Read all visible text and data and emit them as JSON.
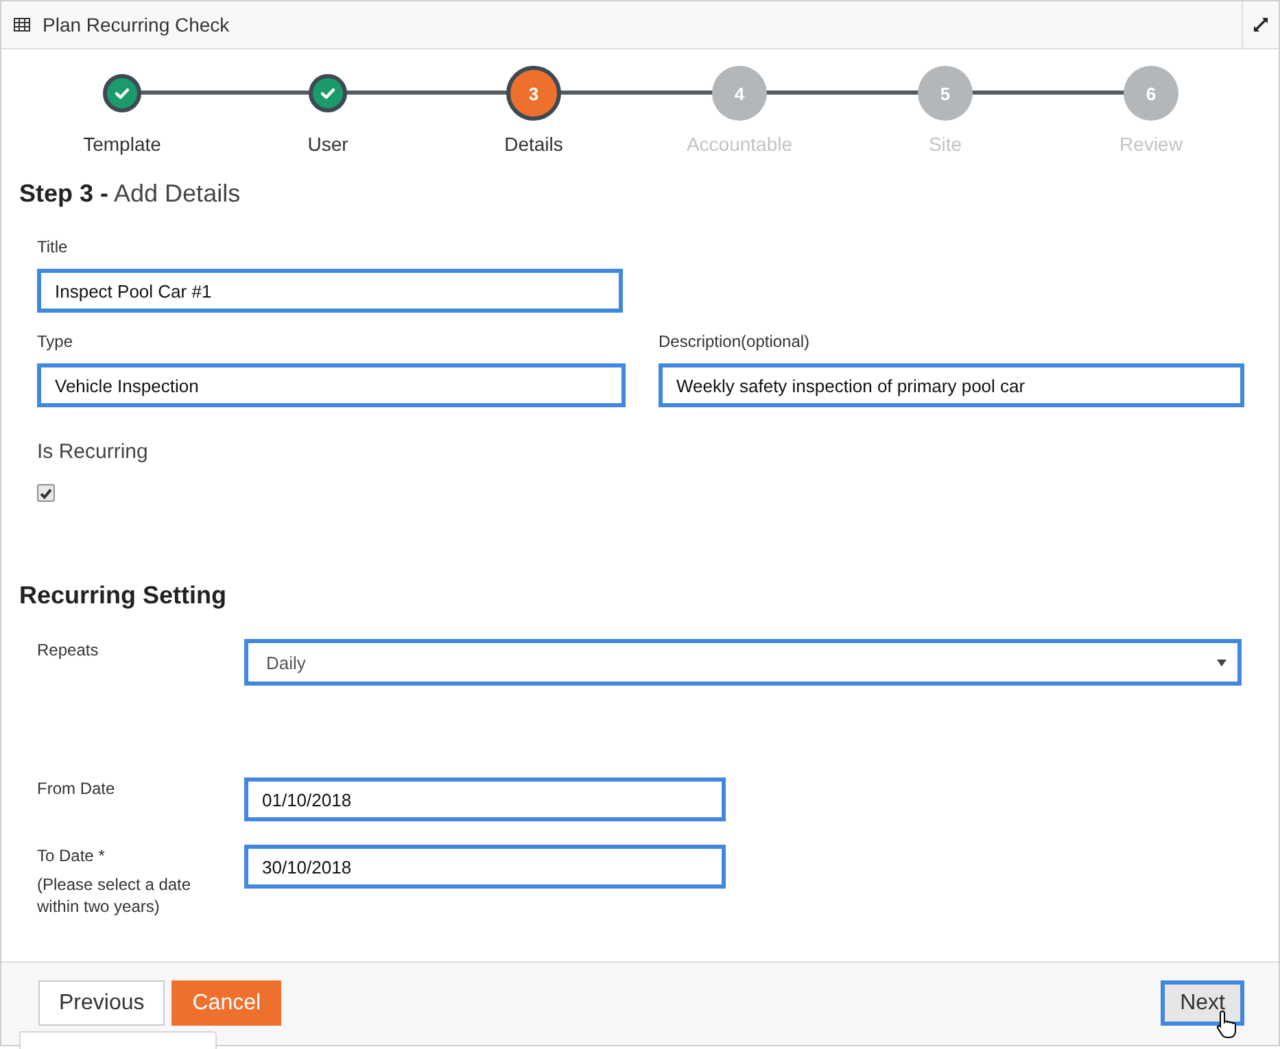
{
  "window": {
    "title": "Plan Recurring Check"
  },
  "steps": [
    {
      "label": "Template",
      "kind": "done"
    },
    {
      "label": "User",
      "kind": "done"
    },
    {
      "number": "3",
      "label": "Details",
      "kind": "current"
    },
    {
      "number": "4",
      "label": "Accountable",
      "kind": "upcoming"
    },
    {
      "number": "5",
      "label": "Site",
      "kind": "upcoming"
    },
    {
      "number": "6",
      "label": "Review",
      "kind": "upcoming"
    }
  ],
  "heading": "**Step 3 -** Add Details",
  "details": {
    "title": {
      "label": "Title",
      "value": "Inspect Pool Car #1"
    },
    "type": {
      "label": "Type",
      "value": "Vehicle Inspection"
    },
    "description": {
      "label": "Description(optional)",
      "value": "Weekly safety inspection of primary pool car"
    }
  },
  "is_recurring": {
    "label": "Is Recurring",
    "checked": true
  },
  "recurring_setting": {
    "heading": "Recurring Setting",
    "repeats": {
      "label": "Repeats",
      "value": "Daily"
    },
    "from_date": {
      "label": "From Date",
      "value": "01/10/2018"
    },
    "to_date": {
      "label": "To Date *",
      "hint": "(Please select a date within two years)",
      "value": "30/10/2018"
    }
  },
  "footer": {
    "left_buttons": [
      {
        "label": "Previous",
        "kind": "plain"
      },
      {
        "label": "Cancel",
        "kind": "warning"
      }
    ],
    "right_buttons": [
      {
        "label": "Next",
        "kind": "highlighted"
      }
    ]
  }
}
